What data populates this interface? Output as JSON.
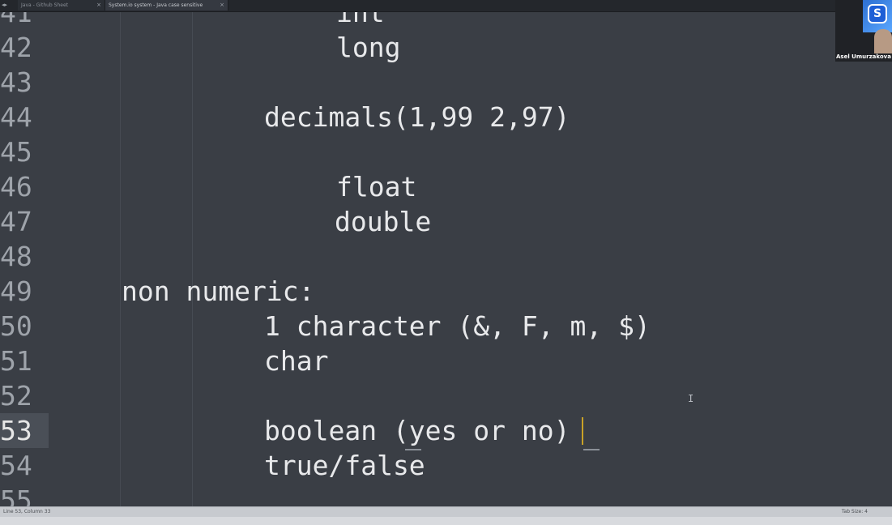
{
  "tabs": [
    {
      "label": "Java - Github Sheet",
      "active": false
    },
    {
      "label": "System.io system - Java case sensitive",
      "active": true
    }
  ],
  "editor": {
    "current_line": "53",
    "lines": [
      {
        "num": "41",
        "text": "int"
      },
      {
        "num": "42",
        "text": "long"
      },
      {
        "num": "43",
        "text": ""
      },
      {
        "num": "44",
        "text": "decimals(1,99 2,97)"
      },
      {
        "num": "45",
        "text": ""
      },
      {
        "num": "46",
        "text": "float"
      },
      {
        "num": "47",
        "text": "double"
      },
      {
        "num": "48",
        "text": ""
      },
      {
        "num": "49",
        "text": "non numeric:"
      },
      {
        "num": "50",
        "text": "1 character (&, F, m, $)"
      },
      {
        "num": "51",
        "text": "char"
      },
      {
        "num": "52",
        "text": ""
      },
      {
        "num": "53",
        "text": "boolean (yes or no)"
      },
      {
        "num": "54",
        "text": "true/false"
      },
      {
        "num": "55",
        "text": ""
      }
    ]
  },
  "statusbar": {
    "position": "Line 53, Column 33",
    "tab_size": "Tab Size: 4"
  },
  "webcam": {
    "name": "Asel Umurzakova"
  },
  "colors": {
    "background": "#3a3e45",
    "text": "#e8e9eb",
    "line_number": "#9ea3aa",
    "caret": "#c9a227"
  }
}
